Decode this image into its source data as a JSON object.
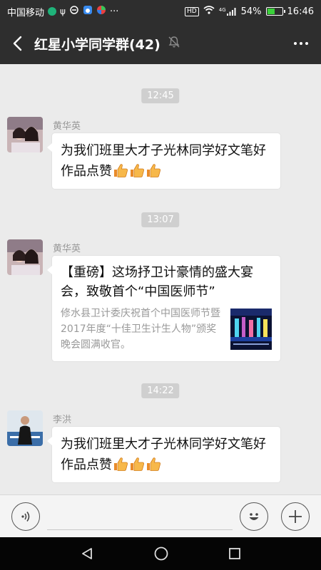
{
  "status_bar": {
    "carrier": "中国移动",
    "extra_icons": "···",
    "network_badge": "HD",
    "signal_label": "4G",
    "battery": "54%",
    "battery_level": 0.54,
    "time": "16:46"
  },
  "header": {
    "title": "红星小学同学群(42)",
    "icons": {
      "back": "chevron-left-icon",
      "mute": "bell-muted-icon",
      "more": "more-icon"
    }
  },
  "messages": [
    {
      "time": "12:45",
      "sender": "黄华英",
      "text": "为我们班里大才子光林同学好文笔好作品点赞",
      "emoji": "thumbs-up-icon",
      "emoji_count": 3
    },
    {
      "time": "13:07",
      "sender": "黄华英",
      "card": {
        "title": "【重磅】这场抒卫计豪情的盛大宴会，致敬首个“中国医师节”",
        "desc": "修水县卫计委庆祝首个中国医师节暨2017年度“十佳卫生计生人物”颁奖晚会圆满收官。"
      }
    },
    {
      "time": "14:22",
      "sender": "李洪",
      "text": "为我们班里大才子光林同学好文笔好作品点赞",
      "emoji": "thumbs-up-icon",
      "emoji_count": 3
    }
  ],
  "input_bar": {
    "icons": {
      "voice": "voice-icon",
      "emoji": "smiley-icon",
      "add": "plus-icon"
    }
  },
  "nav_bar": {
    "icons": {
      "back": "nav-back-icon",
      "home": "nav-home-icon",
      "recent": "nav-recent-icon"
    }
  },
  "colors": {
    "header_bg": "#2e2e2e",
    "chat_bg": "#ebebeb",
    "bubble_bg": "#ffffff",
    "time_badge_bg": "#cfcfcf"
  }
}
